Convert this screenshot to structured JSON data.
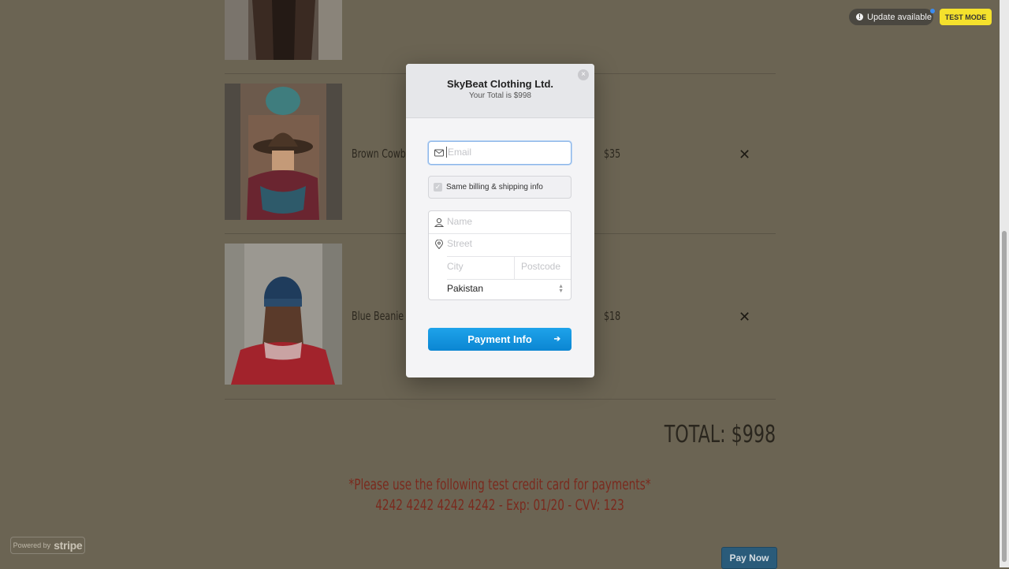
{
  "cart": {
    "items": [
      {
        "name": "Brown Cowbo",
        "price": "$35",
        "remove": "✕"
      },
      {
        "name": "Blue Beanie",
        "price": "$18",
        "remove": "✕"
      }
    ],
    "total": "TOTAL: $998",
    "note_line1": "*Please use the following test credit card for payments*",
    "note_line2": "4242 4242 4242 4242 - Exp: 01/20 - CVV: 123",
    "pay_now": "Pay Now"
  },
  "badges": {
    "update": "Update available",
    "test_mode": "TEST MODE",
    "powered_by": "Powered by",
    "stripe": "stripe"
  },
  "modal": {
    "title": "SkyBeat Clothing Ltd.",
    "subtitle": "Your Total is $998",
    "close": "×",
    "email_placeholder": "Email",
    "same_billing": "Same billing & shipping info",
    "name_placeholder": "Name",
    "street_placeholder": "Street",
    "city_placeholder": "City",
    "postcode_placeholder": "Postcode",
    "country": "Pakistan",
    "payment_button": "Payment Info",
    "payment_arrow": "➔"
  },
  "colors": {
    "overlay": "#6b6453",
    "accent": "#0b86d2",
    "note": "#7a2a1e",
    "test_mode": "#f5e12c"
  }
}
